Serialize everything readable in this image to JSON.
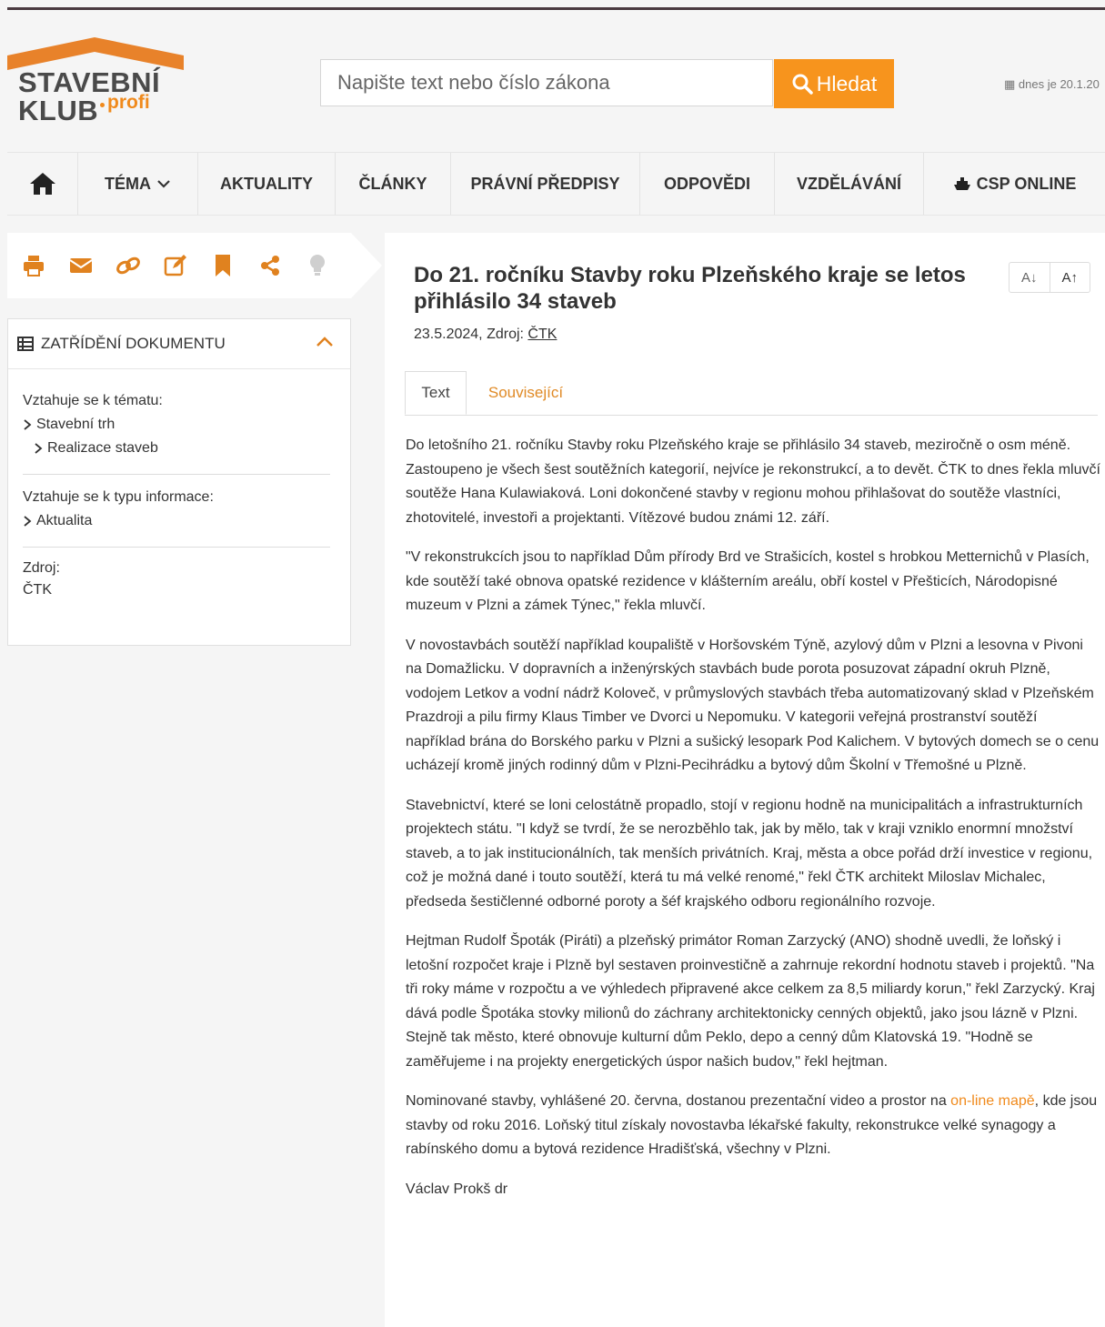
{
  "header": {
    "logo_line1": "STAVEBNÍ",
    "logo_line2": "KLUB",
    "logo_profi": "profi",
    "search_placeholder": "Napište text nebo číslo zákona",
    "search_button": "Hledat",
    "date_text": "dnes je 20.1.20"
  },
  "nav": {
    "items": [
      "TÉMA",
      "AKTUALITY",
      "ČLÁNKY",
      "PRÁVNÍ PŘEDPISY",
      "ODPOVĚDI",
      "VZDĚLÁVÁNÍ",
      "CSP ONLINE"
    ]
  },
  "sidebar": {
    "panel_title": "ZATŘÍDĚNÍ DOKUMENTU",
    "topic_label": "Vztahuje se k tématu:",
    "topic_item1": "Stavební trh",
    "topic_item2": "Realizace staveb",
    "type_label": "Vztahuje se k typu informace:",
    "type_item": "Aktualita",
    "source_label": "Zdroj:",
    "source_value": "ČTK"
  },
  "article": {
    "title": "Do 21. ročníku Stavby roku Plzeňského kraje se letos přihlásilo 34 staveb",
    "date": "23.5.2024, Zdroj:",
    "source": "ČTK",
    "font_smaller": "A↓",
    "font_larger": "A↑",
    "tab_text": "Text",
    "tab_related": "Související",
    "p1": "Do letošního 21. ročníku Stavby roku Plzeňského kraje se přihlásilo 34 staveb, meziročně o osm méně. Zastoupeno je všech šest soutěžních kategorií, nejvíce je rekonstrukcí, a to devět. ČTK to dnes řekla mluvčí soutěže Hana Kulawiaková. Loni dokončené stavby v regionu mohou přihlašovat do soutěže vlastníci, zhotovitelé, investoři a projektanti. Vítězové budou známi 12. září.",
    "p2": "\"V rekonstrukcích jsou to například Dům přírody Brd ve Strašicích, kostel s hrobkou Metternichů v Plasích, kde soutěží také obnova opatské rezidence v klášterním areálu, obří kostel v Přešticích, Národopisné muzeum v Plzni a zámek Týnec,\" řekla mluvčí.",
    "p3": "V novostavbách soutěží například koupaliště v Horšovském Týně, azylový dům v Plzni a lesovna v Pivoni na Domažlicku. V dopravních a inženýrských stavbách bude porota posuzovat západní okruh Plzně, vodojem Letkov a vodní nádrž Koloveč, v průmyslových stavbách třeba automatizovaný sklad v Plzeňském Prazdroji a pilu firmy Klaus Timber ve Dvorci u Nepomuku. V kategorii veřejná prostranství soutěží například brána do Borského parku v Plzni a sušický lesopark Pod Kalichem. V bytových domech se o cenu ucházejí kromě jiných rodinný dům v Plzni-Pecihrádku a bytový dům Školní v Třemošné u Plzně.",
    "p4": "Stavebnictví, které se loni celostátně propadlo, stojí v regionu hodně na municipalitách a infrastrukturních projektech státu. \"I když se tvrdí, že se nerozběhlo tak, jak by mělo, tak v kraji vzniklo enormní množství staveb, a to jak institucionálních, tak menších privátních. Kraj, města a obce pořád drží investice v regionu, což je možná dané i touto soutěží, která tu má velké renomé,\" řekl ČTK architekt Miloslav Michalec, předseda šestičlenné odborné poroty a šéf krajského odboru regionálního rozvoje.",
    "p5": "Hejtman Rudolf Špoták (Piráti) a plzeňský primátor Roman Zarzycký (ANO) shodně uvedli, že loňský i letošní rozpočet kraje i Plzně byl sestaven proinvestičně a zahrnuje rekordní hodnotu staveb i projektů. \"Na tři roky máme v rozpočtu a ve výhledech připravené akce celkem za 8,5 miliardy korun,\" řekl Zarzycký. Kraj dává podle Špotáka stovky milionů do záchrany architektonicky cenných objektů, jako jsou lázně v Plzni. Stejně tak město, které obnovuje kulturní dům Peklo, depo a cenný dům Klatovská 19. \"Hodně se zaměřujeme i na projekty energetických úspor našich budov,\" řekl hejtman.",
    "p6_before": "Nominované stavby, vyhlášené 20. června, dostanou prezentační video a prostor na ",
    "p6_link": "on-line mapě",
    "p6_after": ", kde jsou stavby od roku 2016. Loňský titul získaly novostavba lékařské fakulty, rekonstrukce velké synagogy a rabínského domu a bytová rezidence Hradišťská, všechny v Plzni.",
    "signature": "Václav Prokš dr"
  },
  "colors": {
    "accent": "#f7941d",
    "logo_roof": "#e8822a",
    "icon_orange": "#e0821f"
  }
}
